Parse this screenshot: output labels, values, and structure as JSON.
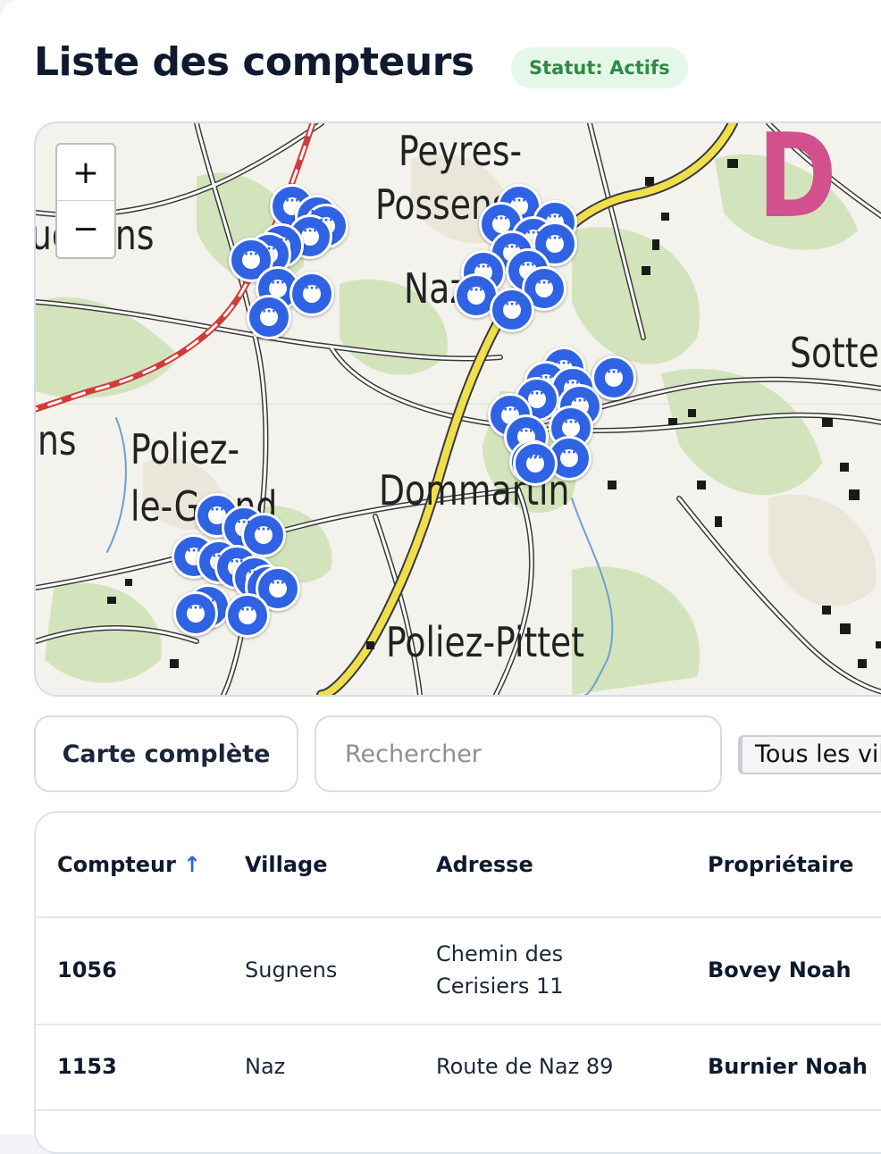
{
  "header": {
    "title": "Liste des compteurs",
    "status_badge": "Statut: Actifs"
  },
  "map": {
    "zoom_in_label": "+",
    "zoom_out_label": "−",
    "place_labels": {
      "peyres": "Peyres-",
      "possens": "Possens",
      "naz": "Naz",
      "sugnens": "Sugnens",
      "sottens": "Sottens",
      "poliez_grand_1": "Poliez-",
      "poliez_grand_2": "le-Grand",
      "dommartin": "Dommartin",
      "poliez_pittet": "Poliez-Pittet",
      "ens": "ns",
      "region_letter": "D"
    },
    "marker_icon": "meter-pin-icon",
    "marker_color": "#2f63e4"
  },
  "toolbar": {
    "full_map_label": "Carte complète",
    "search_placeholder": "Rechercher",
    "village_filter_value": "Tous les villages"
  },
  "table": {
    "columns": {
      "compteur": "Compteur",
      "compteur_sort": "↑",
      "village": "Village",
      "adresse": "Adresse",
      "proprietaire": "Propriétaire"
    },
    "rows": [
      {
        "compteur": "1056",
        "village": "Sugnens",
        "adresse": "Chemin des Cerisiers 11",
        "proprietaire": "Bovey Noah"
      },
      {
        "compteur": "1153",
        "village": "Naz",
        "adresse": "Route de Naz 89",
        "proprietaire": "Burnier Noah"
      }
    ]
  },
  "colors": {
    "accent": "#2f63e4",
    "badge_bg": "#e4f7e8",
    "badge_text": "#2f8a45"
  }
}
